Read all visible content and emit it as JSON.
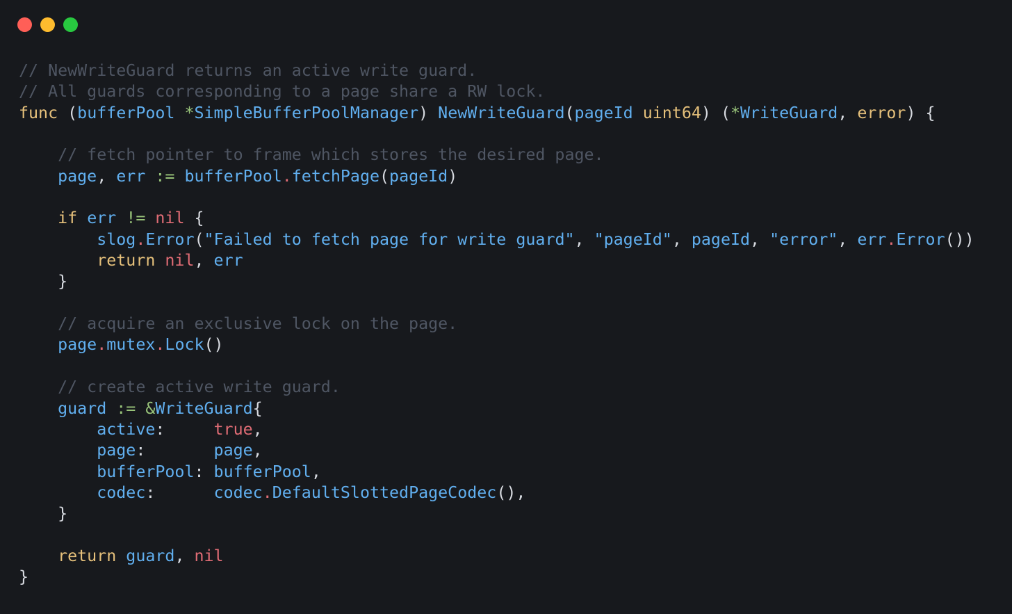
{
  "window": {
    "controls": [
      {
        "name": "close-button",
        "color": "#ff5f57"
      },
      {
        "name": "minimize-button",
        "color": "#febc2e"
      },
      {
        "name": "maximize-button",
        "color": "#28c840"
      }
    ]
  },
  "theme": {
    "background": "#17191d",
    "comment": "#4f5663",
    "keyword": "#e5c07b",
    "identifier": "#61afef",
    "literal": "#e06c75",
    "operator": "#98c379",
    "plain": "#d7dae0"
  },
  "code": {
    "language": "go",
    "lines": [
      [
        [
          "comment",
          "// NewWriteGuard returns an active write guard."
        ]
      ],
      [
        [
          "comment",
          "// All guards corresponding to a page share a RW lock."
        ]
      ],
      [
        [
          "keyword",
          "func"
        ],
        [
          "plain",
          " ("
        ],
        [
          "ident",
          "bufferPool"
        ],
        [
          "plain",
          " "
        ],
        [
          "op",
          "*"
        ],
        [
          "ident",
          "SimpleBufferPoolManager"
        ],
        [
          "plain",
          ") "
        ],
        [
          "ident",
          "NewWriteGuard"
        ],
        [
          "plain",
          "("
        ],
        [
          "ident",
          "pageId"
        ],
        [
          "plain",
          " "
        ],
        [
          "type",
          "uint64"
        ],
        [
          "plain",
          ") ("
        ],
        [
          "op",
          "*"
        ],
        [
          "ident",
          "WriteGuard"
        ],
        [
          "plain",
          ", "
        ],
        [
          "type",
          "error"
        ],
        [
          "plain",
          ") {"
        ]
      ],
      [],
      [
        [
          "plain",
          "    "
        ],
        [
          "comment",
          "// fetch pointer to frame which stores the desired page."
        ]
      ],
      [
        [
          "plain",
          "    "
        ],
        [
          "ident",
          "page"
        ],
        [
          "plain",
          ", "
        ],
        [
          "ident",
          "err"
        ],
        [
          "plain",
          " "
        ],
        [
          "op",
          ":="
        ],
        [
          "plain",
          " "
        ],
        [
          "ident",
          "bufferPool"
        ],
        [
          "dot",
          "."
        ],
        [
          "ident",
          "fetchPage"
        ],
        [
          "plain",
          "("
        ],
        [
          "ident",
          "pageId"
        ],
        [
          "plain",
          ")"
        ]
      ],
      [],
      [
        [
          "plain",
          "    "
        ],
        [
          "keyword",
          "if"
        ],
        [
          "plain",
          " "
        ],
        [
          "ident",
          "err"
        ],
        [
          "plain",
          " "
        ],
        [
          "op",
          "!="
        ],
        [
          "plain",
          " "
        ],
        [
          "literal",
          "nil"
        ],
        [
          "plain",
          " {"
        ]
      ],
      [
        [
          "plain",
          "        "
        ],
        [
          "ident",
          "slog"
        ],
        [
          "dot",
          "."
        ],
        [
          "ident",
          "Error"
        ],
        [
          "plain",
          "("
        ],
        [
          "string",
          "\"Failed to fetch page for write guard\""
        ],
        [
          "plain",
          ", "
        ],
        [
          "string",
          "\"pageId\""
        ],
        [
          "plain",
          ", "
        ],
        [
          "ident",
          "pageId"
        ],
        [
          "plain",
          ", "
        ],
        [
          "string",
          "\"error\""
        ],
        [
          "plain",
          ", "
        ],
        [
          "ident",
          "err"
        ],
        [
          "dot",
          "."
        ],
        [
          "ident",
          "Error"
        ],
        [
          "plain",
          "())"
        ]
      ],
      [
        [
          "plain",
          "        "
        ],
        [
          "keyword",
          "return"
        ],
        [
          "plain",
          " "
        ],
        [
          "literal",
          "nil"
        ],
        [
          "plain",
          ", "
        ],
        [
          "ident",
          "err"
        ]
      ],
      [
        [
          "plain",
          "    }"
        ]
      ],
      [],
      [
        [
          "plain",
          "    "
        ],
        [
          "comment",
          "// acquire an exclusive lock on the page."
        ]
      ],
      [
        [
          "plain",
          "    "
        ],
        [
          "ident",
          "page"
        ],
        [
          "dot",
          "."
        ],
        [
          "ident",
          "mutex"
        ],
        [
          "dot",
          "."
        ],
        [
          "ident",
          "Lock"
        ],
        [
          "plain",
          "()"
        ]
      ],
      [],
      [
        [
          "plain",
          "    "
        ],
        [
          "comment",
          "// create active write guard."
        ]
      ],
      [
        [
          "plain",
          "    "
        ],
        [
          "ident",
          "guard"
        ],
        [
          "plain",
          " "
        ],
        [
          "op",
          ":="
        ],
        [
          "plain",
          " "
        ],
        [
          "op",
          "&"
        ],
        [
          "ident",
          "WriteGuard"
        ],
        [
          "plain",
          "{"
        ]
      ],
      [
        [
          "plain",
          "        "
        ],
        [
          "ident",
          "active"
        ],
        [
          "plain",
          ":     "
        ],
        [
          "literal",
          "true"
        ],
        [
          "plain",
          ","
        ]
      ],
      [
        [
          "plain",
          "        "
        ],
        [
          "ident",
          "page"
        ],
        [
          "plain",
          ":       "
        ],
        [
          "ident",
          "page"
        ],
        [
          "plain",
          ","
        ]
      ],
      [
        [
          "plain",
          "        "
        ],
        [
          "ident",
          "bufferPool"
        ],
        [
          "plain",
          ": "
        ],
        [
          "ident",
          "bufferPool"
        ],
        [
          "plain",
          ","
        ]
      ],
      [
        [
          "plain",
          "        "
        ],
        [
          "ident",
          "codec"
        ],
        [
          "plain",
          ":      "
        ],
        [
          "ident",
          "codec"
        ],
        [
          "dot",
          "."
        ],
        [
          "ident",
          "DefaultSlottedPageCodec"
        ],
        [
          "plain",
          "(),"
        ]
      ],
      [
        [
          "plain",
          "    }"
        ]
      ],
      [],
      [
        [
          "plain",
          "    "
        ],
        [
          "keyword",
          "return"
        ],
        [
          "plain",
          " "
        ],
        [
          "ident",
          "guard"
        ],
        [
          "plain",
          ", "
        ],
        [
          "literal",
          "nil"
        ]
      ],
      [
        [
          "plain",
          "}"
        ]
      ]
    ]
  }
}
